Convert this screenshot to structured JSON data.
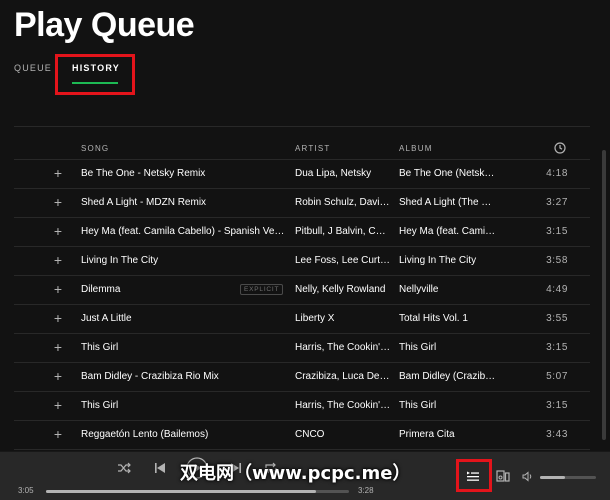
{
  "header": {
    "title": "Play Queue",
    "tabs": [
      {
        "label": "QUEUE",
        "active": false
      },
      {
        "label": "HISTORY",
        "active": true
      }
    ]
  },
  "table": {
    "columns": {
      "song": "SONG",
      "artist": "ARTIST",
      "album": "ALBUM",
      "duration_icon": "clock-icon"
    },
    "add_icon": "plus-icon",
    "rows": [
      {
        "song": "Be The One - Netsky Remix",
        "artist": "Dua Lipa, Netsky",
        "album": "Be The One (Netsky Remix)",
        "duration": "4:18",
        "explicit": false
      },
      {
        "song": "Shed A Light - MDZN Remix",
        "artist": "Robin Schulz, David Guetta",
        "album": "Shed A Light (The Remixes)",
        "duration": "3:27",
        "explicit": false
      },
      {
        "song": "Hey Ma (feat. Camila Cabello) - Spanish Version",
        "artist": "Pitbull, J Balvin, Camila Cabello",
        "album": "Hey Ma (feat. Camila Cabello)",
        "duration": "3:15",
        "explicit": false
      },
      {
        "song": "Living In The City",
        "artist": "Lee Foss, Lee Curtiss",
        "album": "Living In The City",
        "duration": "3:58",
        "explicit": false
      },
      {
        "song": "Dilemma",
        "artist": "Nelly, Kelly Rowland",
        "album": "Nellyville",
        "duration": "4:49",
        "explicit": true
      },
      {
        "song": "Just A Little",
        "artist": "Liberty X",
        "album": "Total Hits Vol. 1",
        "duration": "3:55",
        "explicit": false
      },
      {
        "song": "This Girl",
        "artist": "Harris, The Cookin' Books",
        "album": "This Girl",
        "duration": "3:15",
        "explicit": false
      },
      {
        "song": "Bam Didley - Crazibiza Rio Mix",
        "artist": "Crazibiza, Luca Debonaire",
        "album": "Bam Didley (Crazibiza Rio Mix)",
        "duration": "5:07",
        "explicit": false
      },
      {
        "song": "This Girl",
        "artist": "Harris, The Cookin' Books",
        "album": "This Girl",
        "duration": "3:15",
        "explicit": false
      },
      {
        "song": "Reggaetón Lento (Bailemos)",
        "artist": "CNCO",
        "album": "Primera Cita",
        "duration": "3:43",
        "explicit": false
      }
    ],
    "explicit_label": "EXPLICIT"
  },
  "player": {
    "elapsed": "3:05",
    "total": "3:28",
    "progress_fraction": 0.89,
    "volume_fraction": 0.45,
    "icons": [
      "shuffle-icon",
      "previous-icon",
      "play-icon",
      "next-icon",
      "repeat-icon",
      "queue-icon",
      "devices-icon",
      "volume-icon"
    ]
  },
  "colors": {
    "background": "#121212",
    "player_bar": "#282828",
    "accent": "#1db954",
    "highlight": "#e3141b",
    "secondary_text": "#b3b3b3"
  },
  "watermark": "双电网（www.pcpc.me）"
}
